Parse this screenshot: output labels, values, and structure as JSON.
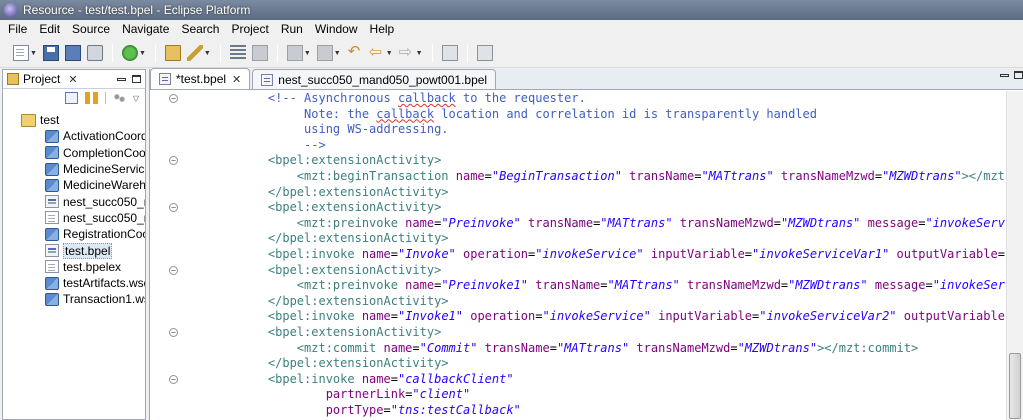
{
  "window": {
    "title": "Resource - test/test.bpel - Eclipse Platform"
  },
  "menu": [
    "File",
    "Edit",
    "Source",
    "Navigate",
    "Search",
    "Project",
    "Run",
    "Window",
    "Help"
  ],
  "project_panel": {
    "tab_label": "Project",
    "tree": [
      {
        "label": "test",
        "icon": "folder-icon",
        "level": 0
      },
      {
        "label": "ActivationCoord",
        "icon": "wsdl-icon",
        "level": 1
      },
      {
        "label": "CompletionCoor",
        "icon": "wsdl-icon",
        "level": 1
      },
      {
        "label": "MedicineService.",
        "icon": "wsdl-icon",
        "level": 1
      },
      {
        "label": "MedicineWareh",
        "icon": "wsdl-icon",
        "level": 1
      },
      {
        "label": "nest_succ050_ma",
        "icon": "bpel-icon",
        "level": 1
      },
      {
        "label": "nest_succ050_ma",
        "icon": "file-icon",
        "level": 1
      },
      {
        "label": "RegistrationCoor",
        "icon": "wsdl-icon",
        "level": 1
      },
      {
        "label": "test.bpel",
        "icon": "bpel-icon",
        "level": 1,
        "selected": true
      },
      {
        "label": "test.bpelex",
        "icon": "file-icon",
        "level": 1
      },
      {
        "label": "testArtifacts.wsd",
        "icon": "wsdl-icon",
        "level": 1
      },
      {
        "label": "Transaction1.wsc",
        "icon": "wsdl-icon",
        "level": 1
      }
    ]
  },
  "editor": {
    "tabs": [
      {
        "label": "*test.bpel",
        "active": true,
        "closable": true
      },
      {
        "label": "nest_succ050_mand050_powt001.bpel",
        "active": false,
        "closable": false
      }
    ],
    "lines": [
      {
        "fold": true,
        "parts": [
          [
            "c",
            "    <!-- Asynchronous "
          ],
          [
            "cs",
            "callback"
          ],
          [
            "c",
            " to the requester."
          ]
        ]
      },
      {
        "fold": false,
        "parts": [
          [
            "c",
            "         Note: the "
          ],
          [
            "cs",
            "callback"
          ],
          [
            "c",
            " location and correlation id is transparently handled"
          ]
        ]
      },
      {
        "fold": false,
        "parts": [
          [
            "c",
            "         using WS-addressing."
          ]
        ]
      },
      {
        "fold": false,
        "parts": [
          [
            "c",
            "         -->"
          ]
        ]
      },
      {
        "fold": true,
        "parts": [
          [
            "t",
            "    <bpel:extensionActivity>"
          ]
        ]
      },
      {
        "fold": false,
        "parts": [
          [
            "t",
            "        <mzt:beginTransaction "
          ],
          [
            "a",
            "name"
          ],
          [
            "p",
            "="
          ],
          [
            "v",
            "\"BeginTransaction\""
          ],
          [
            "p",
            " "
          ],
          [
            "a",
            "transName"
          ],
          [
            "p",
            "="
          ],
          [
            "v",
            "\"MATtrans\""
          ],
          [
            "p",
            " "
          ],
          [
            "a",
            "transNameMzwd"
          ],
          [
            "p",
            "="
          ],
          [
            "v",
            "\"MZWDtrans\""
          ],
          [
            "t",
            "></mzt:be"
          ]
        ]
      },
      {
        "fold": false,
        "parts": [
          [
            "t",
            "    </bpel:extensionActivity>"
          ]
        ]
      },
      {
        "fold": true,
        "parts": [
          [
            "t",
            "    <bpel:extensionActivity>"
          ]
        ]
      },
      {
        "fold": false,
        "parts": [
          [
            "t",
            "        <mzt:preinvoke "
          ],
          [
            "a",
            "name"
          ],
          [
            "p",
            "="
          ],
          [
            "v",
            "\"Preinvoke\""
          ],
          [
            "p",
            " "
          ],
          [
            "a",
            "transName"
          ],
          [
            "p",
            "="
          ],
          [
            "v",
            "\"MATtrans\""
          ],
          [
            "p",
            " "
          ],
          [
            "a",
            "transNameMzwd"
          ],
          [
            "p",
            "="
          ],
          [
            "v",
            "\"MZWDtrans\""
          ],
          [
            "p",
            " "
          ],
          [
            "a",
            "message"
          ],
          [
            "p",
            "="
          ],
          [
            "v",
            "\"invokeService"
          ]
        ]
      },
      {
        "fold": false,
        "parts": [
          [
            "t",
            "    </bpel:extensionActivity>"
          ]
        ]
      },
      {
        "fold": false,
        "parts": [
          [
            "t",
            "    <bpel:invoke "
          ],
          [
            "a",
            "name"
          ],
          [
            "p",
            "="
          ],
          [
            "v",
            "\"Invoke\""
          ],
          [
            "p",
            " "
          ],
          [
            "a",
            "operation"
          ],
          [
            "p",
            "="
          ],
          [
            "v",
            "\"invokeService\""
          ],
          [
            "p",
            " "
          ],
          [
            "a",
            "inputVariable"
          ],
          [
            "p",
            "="
          ],
          [
            "v",
            "\"invokeServiceVar1\""
          ],
          [
            "p",
            " "
          ],
          [
            "a",
            "outputVariable"
          ],
          [
            "p",
            "="
          ],
          [
            "v",
            "\"ir"
          ]
        ]
      },
      {
        "fold": true,
        "parts": [
          [
            "t",
            "    <bpel:extensionActivity>"
          ]
        ]
      },
      {
        "fold": false,
        "parts": [
          [
            "t",
            "        <mzt:preinvoke "
          ],
          [
            "a",
            "name"
          ],
          [
            "p",
            "="
          ],
          [
            "v",
            "\"Preinvoke1\""
          ],
          [
            "p",
            " "
          ],
          [
            "a",
            "transName"
          ],
          [
            "p",
            "="
          ],
          [
            "v",
            "\"MATtrans\""
          ],
          [
            "p",
            " "
          ],
          [
            "a",
            "transNameMzwd"
          ],
          [
            "p",
            "="
          ],
          [
            "v",
            "\"MZWDtrans\""
          ],
          [
            "p",
            " "
          ],
          [
            "a",
            "message"
          ],
          [
            "p",
            "="
          ],
          [
            "v",
            "\"invokeServic"
          ]
        ]
      },
      {
        "fold": false,
        "parts": [
          [
            "t",
            "    </bpel:extensionActivity>"
          ]
        ]
      },
      {
        "fold": false,
        "parts": [
          [
            "t",
            "    <bpel:invoke "
          ],
          [
            "a",
            "name"
          ],
          [
            "p",
            "="
          ],
          [
            "v",
            "\"Invoke1\""
          ],
          [
            "p",
            " "
          ],
          [
            "a",
            "operation"
          ],
          [
            "p",
            "="
          ],
          [
            "v",
            "\"invokeService\""
          ],
          [
            "p",
            " "
          ],
          [
            "a",
            "inputVariable"
          ],
          [
            "p",
            "="
          ],
          [
            "v",
            "\"invokeServiceVar2\""
          ],
          [
            "p",
            " "
          ],
          [
            "a",
            "outputVariable"
          ],
          [
            "p",
            "="
          ],
          [
            "v",
            "\"i"
          ]
        ]
      },
      {
        "fold": true,
        "parts": [
          [
            "t",
            "    <bpel:extensionActivity>"
          ]
        ]
      },
      {
        "fold": false,
        "parts": [
          [
            "t",
            "        <mzt:commit "
          ],
          [
            "a",
            "name"
          ],
          [
            "p",
            "="
          ],
          [
            "v",
            "\"Commit\""
          ],
          [
            "p",
            " "
          ],
          [
            "a",
            "transName"
          ],
          [
            "p",
            "="
          ],
          [
            "v",
            "\"MATtrans\""
          ],
          [
            "p",
            " "
          ],
          [
            "a",
            "transNameMzwd"
          ],
          [
            "p",
            "="
          ],
          [
            "v",
            "\"MZWDtrans\""
          ],
          [
            "t",
            "></mzt:commit>"
          ]
        ]
      },
      {
        "fold": false,
        "parts": [
          [
            "t",
            "    </bpel:extensionActivity>"
          ]
        ]
      },
      {
        "fold": true,
        "parts": [
          [
            "t",
            "    <bpel:invoke "
          ],
          [
            "a",
            "name"
          ],
          [
            "p",
            "="
          ],
          [
            "v",
            "\"callbackClient\""
          ]
        ]
      },
      {
        "fold": false,
        "parts": [
          [
            "p",
            "            "
          ],
          [
            "a",
            "partnerLink"
          ],
          [
            "p",
            "="
          ],
          [
            "v",
            "\"client\""
          ]
        ]
      },
      {
        "fold": false,
        "parts": [
          [
            "p",
            "            "
          ],
          [
            "a",
            "portType"
          ],
          [
            "p",
            "="
          ],
          [
            "v",
            "\"tns:testCallback\""
          ]
        ]
      }
    ]
  },
  "colors": {
    "comment": "#3f5fbf",
    "tag": "#3f7f7f",
    "attribute": "#7f007f",
    "value": "#2a00ff"
  }
}
